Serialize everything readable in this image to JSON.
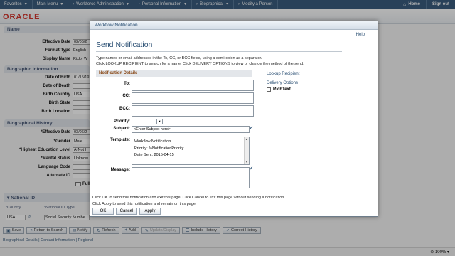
{
  "topnav": {
    "favorites": "Favorites",
    "main_menu": "Main Menu",
    "workforce_admin": "Workforce Administration",
    "personal_info": "Personal Information",
    "biographical": "Biographical",
    "modify_person": "Modify a Person",
    "home": "Home",
    "sign_out": "Sign out"
  },
  "header": {
    "logo": "ORACLE"
  },
  "background": {
    "name_section": "Name",
    "effective_date_label": "Effective Date",
    "effective_date_value": "03/06/2",
    "format_type_label": "Format Type",
    "format_type_value": "English",
    "display_name_label": "Display Name",
    "display_name_value": "Ricky W",
    "bio_info_section": "Biographic Information",
    "dob_label": "Date of Birth",
    "dob_value": "01/15/197",
    "dod_label": "Date of Death",
    "birth_country_label": "Birth Country",
    "birth_country_value": "USA",
    "birth_state_label": "Birth State",
    "birth_location_label": "Birth Location",
    "bio_history_section": "Biographical History",
    "eff_date_label": "*Effective Date",
    "eff_date_value": "03/06/2",
    "gender_label": "*Gender",
    "gender_value": "Male",
    "highest_edu_label": "*Highest Education Level",
    "highest_edu_value": "A-Not I",
    "marital_label": "*Marital Status",
    "marital_value": "Unknow",
    "language_label": "Language Code",
    "alternate_id_label": "Alternate ID",
    "full_label": "Full",
    "national_id_section": "National ID",
    "country_col": "*Country",
    "national_id_type_col": "*National ID Type",
    "country_value": "USA",
    "id_type_value": "Social Security Numbe"
  },
  "toolbar": {
    "save": "Save",
    "return_to_search": "Return to Search",
    "notify": "Notify",
    "refresh": "Refresh",
    "add": "Add",
    "update_display": "Update/Display",
    "include_history": "Include History",
    "correct_history": "Correct History"
  },
  "bottom_links": "Biographical Details | Contact Information | Regional",
  "status": {
    "zoom": "100%"
  },
  "modal": {
    "title": "Workflow Notification",
    "help": "Help",
    "heading": "Send Notification",
    "instruction1": "Type names or email addresses in the To, CC, or BCC fields, using a semi-colon as a separator.",
    "instruction2": "Click LOOKUP RECIPIENT to search for a name.  Click DELIVERY OPTIONS to view or change the method of the send.",
    "details_header": "Notification Details",
    "to_label": "To:",
    "cc_label": "CC:",
    "bcc_label": "BCC:",
    "priority_label": "Priority:",
    "subject_label": "Subject:",
    "subject_value": "<Enter Subject here>",
    "template_label": "Template:",
    "template_lines": [
      "Workflow Notification",
      "Priority:  %NotificationPriority",
      "Date Sent:  2015-04-15"
    ],
    "message_label": "Message:",
    "lookup_recipient": "Lookup Recipient",
    "delivery_options": "Delivery Options",
    "richtext": "RichText",
    "bottom1": "Click OK to send this notification and exit this page.  Click Cancel to exit this page without sending a notification.",
    "bottom2": "Click Apply to send this notification and remain on this page.",
    "ok": "OK",
    "cancel": "Cancel",
    "apply": "Apply"
  }
}
